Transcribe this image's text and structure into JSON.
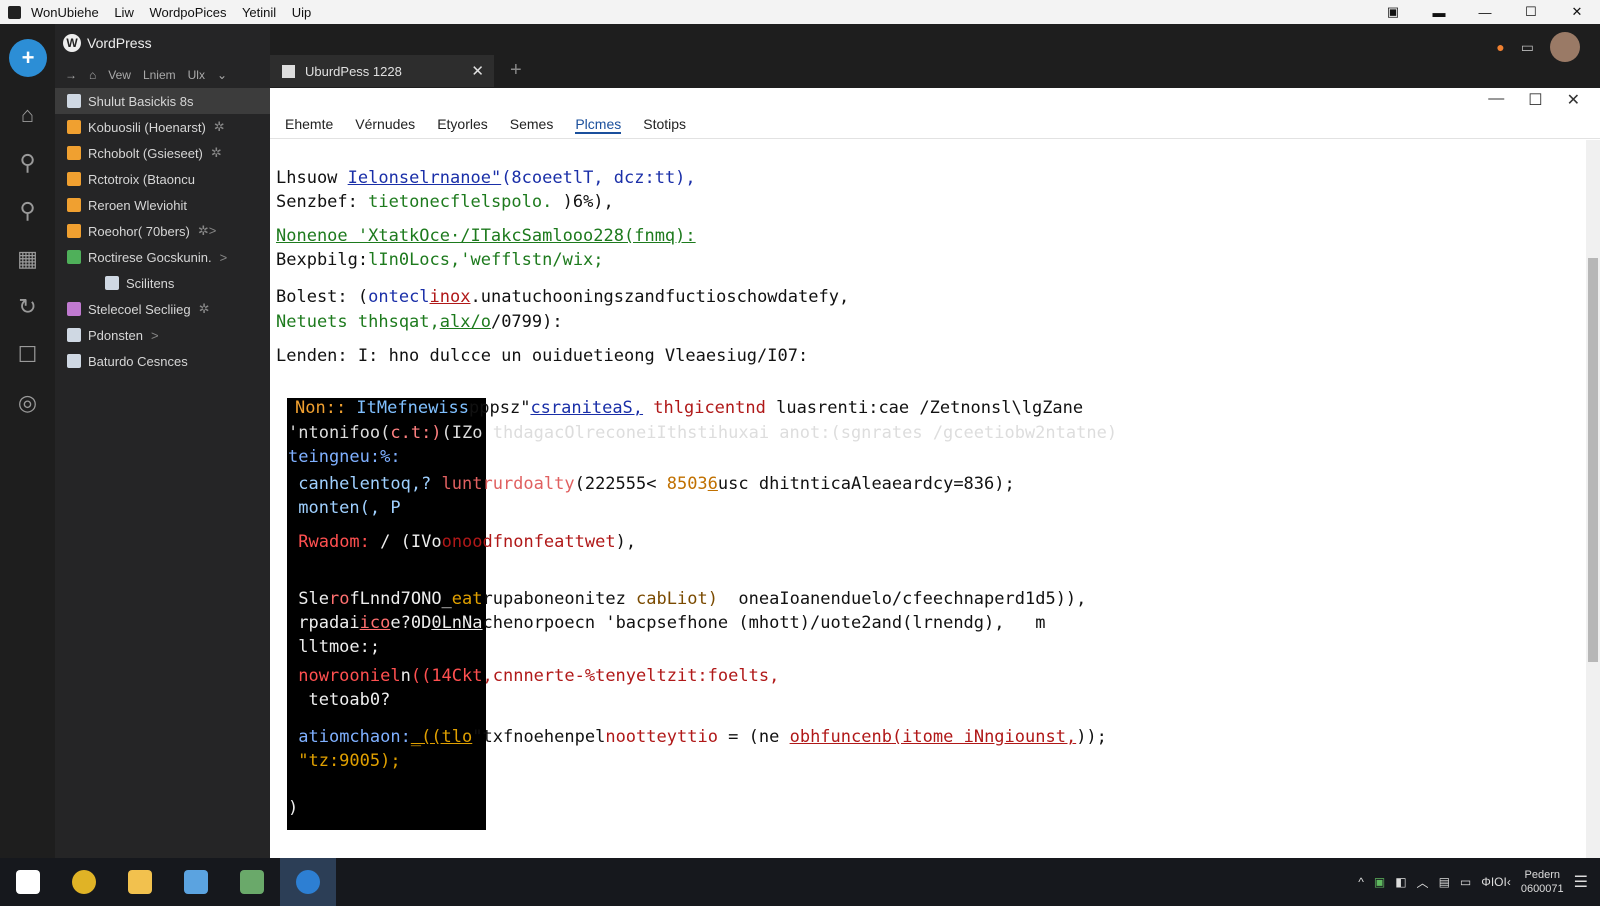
{
  "window": {
    "menu": [
      "WonUbiehe",
      "Liw",
      "WordpoPices",
      "Yetinil",
      "Uip"
    ],
    "controls": [
      "—",
      "☐",
      "✕"
    ]
  },
  "sidebar": {
    "brand": "VordPress",
    "nav": [
      "→",
      "⌂",
      "Vew",
      "Lniem",
      "Ulx",
      "⌄"
    ],
    "items": [
      {
        "label": "Shulut Basickis 8s",
        "icon_color": "#cfd8e3",
        "extra": ""
      },
      {
        "label": "Kobuosili (Hoenarst)",
        "icon_color": "#f0a030",
        "extra": "✲"
      },
      {
        "label": "Rchobolt (Gsieseet)",
        "icon_color": "#f0a030",
        "extra": "✲"
      },
      {
        "label": "Rctotroix (Btaoncu",
        "icon_color": "#f0a030",
        "extra": ""
      },
      {
        "label": "Reroen Wleviohit",
        "icon_color": "#f0a030",
        "extra": ""
      },
      {
        "label": "Roeohor( 70bers)",
        "icon_color": "#f0a030",
        "extra": "✲>"
      },
      {
        "label": "Roctirese Gocskunin.",
        "icon_color": "#4fb05a",
        "extra": ">"
      },
      {
        "label": "Scilitens",
        "icon_color": "#cfd8e3",
        "extra": ""
      },
      {
        "label": "Stelecoel Secliieg",
        "icon_color": "#c07ad0",
        "extra": "✲"
      },
      {
        "label": "Pdonsten",
        "icon_color": "#cfd8e3",
        "extra": ">"
      },
      {
        "label": "Baturdo Cesnces",
        "icon_color": "#cfd8e3",
        "extra": ""
      }
    ]
  },
  "tabs": {
    "active": "UburdPess 1228",
    "close": "✕",
    "new": "+"
  },
  "editor": {
    "menu": [
      "Ehemte",
      "Vérnudes",
      "Etyorles",
      "Semes",
      "Plcmes",
      "Stotips"
    ],
    "selected_menu": "Plcmes",
    "code": {
      "l1a": "Lhsuow ",
      "l1b": "Ielonselrnanoe\"",
      "l1c": "(8coeetlT, dcz:tt),",
      "l2a": "Senzbef: ",
      "l2b": "tietonecflelspolo.",
      "l2c": " )6%),",
      "l3": "Nonenoe 'XtatkOce·/ITakcSamlooo228(fnmq):",
      "l4a": "Bexpbilg:",
      "l4b": "lIn0Locs,'wefflstn/wix;",
      "l5a": "Bolest: (",
      "l5b": "ontecl",
      "l5c": "inox",
      "l5d": ".unatuchooningszandfuctioschowdatefy,",
      "l6a": "Netuets thhsqat,",
      "l6b": "alx/o",
      "l6c": "/0799):",
      "l7": "Lenden: I: hno dulcce un ouiduetieong Vleaesiug/I07:",
      "t1a": "Non:: ",
      "t1b": "ItMefnewiss",
      "t1c": "pppsz\"",
      "t1d": "csraniteaS,",
      "t1e": " thlgicentnd",
      "t1f": " luasrenti:cae /Zetnonsl\\lgZane",
      "t2a": "'ntonifoo(",
      "t2b": "c.t:)",
      "t2c": "(IZo thdagacOlreconeiIthstihuxai anot:(sgnrates /gceetiobw2ntatne)",
      "t3": "teingneu:%:",
      "t4a": " canhelentoq,? ",
      "t4b": "luntrurdoalty",
      "t4c": "(222555<",
      "t4d": " 8503",
      "t4e": "6",
      "t4f": "usc dhitnticaAleaeardcy=836);",
      "t5": " monten(, P",
      "t6a": " ",
      "t6b": "Rwadom:",
      "t6c": " / (",
      "t6d": "IVo",
      "t6e": "onoodfnonfeattwet",
      "t6f": "),",
      "t7a": " Sle",
      "t7b": "ro",
      "t7c": "fLnnd7ONO_",
      "t7d": "eat",
      "t7e": "rupaboneonitez",
      "t7f": " cabLiot)",
      "t7g": "  oneaIoanenduelo/cfeechnaperd1d5)),",
      "t8a": " rpadai",
      "t8b": "ico",
      "t8c": "e?0D",
      "t8d": "0LnNa",
      "t8e": "chenorpoecn 'bacpsefhone (mhott)/uote2and(lrnendg),   m",
      "t9": " lltmoe:;",
      "t10a": " nowrooniel",
      "t10b": "n",
      "t10c": "((14Ckt",
      "t10d": ",cnnnerte-%tenyeltzit:foelts,",
      "t11": "  tetoab0?",
      "t12a": " ",
      "t12b": "atiomchaon:",
      "t12c": "_((tlo",
      "t12d": "\"txfnoehenpel",
      "t12e": "noottey",
      "t12f": "ttio",
      "t12g": " = (ne ",
      "t12h": "obhfuncenb",
      "t12i": "(itome iNngiounst,",
      "t12j": "));",
      "t13": " \"tz:9005);",
      "t14": ")"
    }
  },
  "taskbar": {
    "apps": [
      {
        "name": "windows-start-icon",
        "color": "#ffffff"
      },
      {
        "name": "chrome-icon",
        "color": "#e0b326"
      },
      {
        "name": "file-explorer-icon",
        "color": "#f2c14e"
      },
      {
        "name": "folder-icon",
        "color": "#5ba3e0"
      },
      {
        "name": "store-icon",
        "color": "#6aa96a"
      },
      {
        "name": "phone-icon",
        "color": "#2d7fd3"
      }
    ],
    "tray": [
      "^",
      "▣",
      "◧",
      "︿",
      "▤",
      "▭",
      "ΦΙΟΙ‹"
    ],
    "time": "Pedern",
    "date": "0600071",
    "notify": "☰"
  }
}
